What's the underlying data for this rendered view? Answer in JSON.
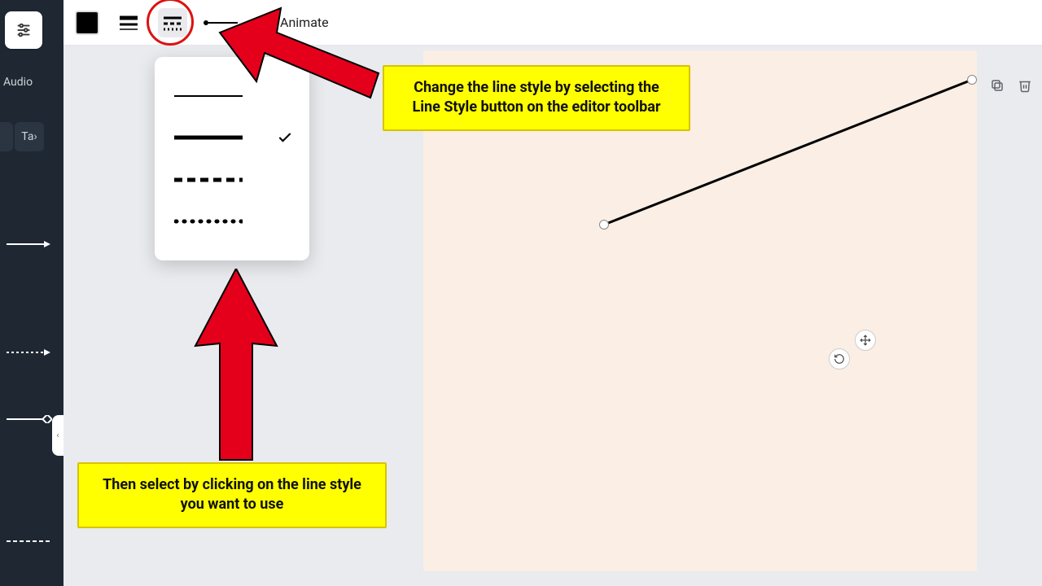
{
  "sidebar": {
    "audio_label": "Audio",
    "tab_chip": "Ta"
  },
  "toolbar": {
    "animate_label": "Animate"
  },
  "style_popup": {
    "options": [
      "thin-solid",
      "solid",
      "dashed",
      "dotted"
    ],
    "selected_index": 1
  },
  "annotations": {
    "callout_top": "Change the line style by selecting the Line Style button on the editor toolbar",
    "callout_bottom": "Then select by clicking on the line style you want to use"
  },
  "page_controls": {
    "collapse_tooltip": "‹"
  }
}
